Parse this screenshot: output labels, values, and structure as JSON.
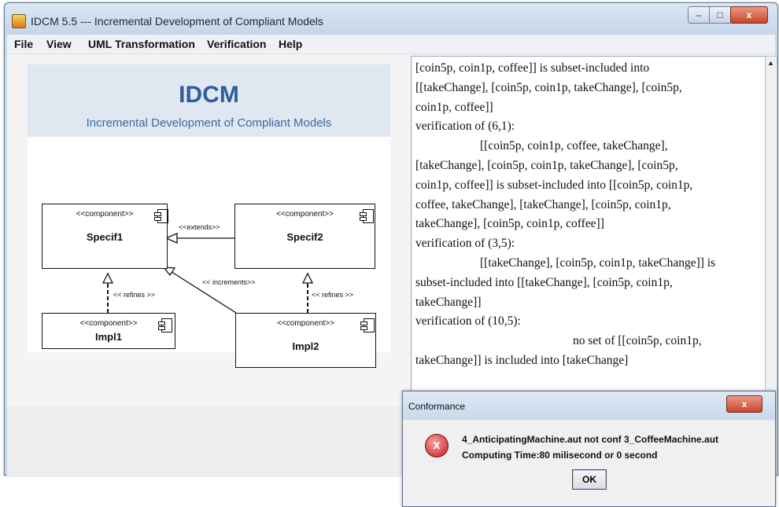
{
  "window": {
    "title": "IDCM 5.5 --- Incremental Development of Compliant Models",
    "icon": "java-app-icon",
    "controls": {
      "minimize": "–",
      "maximize": "□",
      "close": "x"
    }
  },
  "menu": [
    "File",
    "View",
    "UML Transformation",
    "Verification",
    "Help"
  ],
  "banner": {
    "title": "IDCM",
    "subtitle": "Incremental Development of Compliant Models"
  },
  "diagram": {
    "stereotype": "<<component>>",
    "components": [
      "Specif1",
      "Specif2",
      "Impl1",
      "Impl2"
    ],
    "relations": [
      "<<extends>>",
      "<< increments>>",
      "<< refines >>",
      "<< refines >>"
    ]
  },
  "output_lines": [
    "[coin5p, coin1p, coffee]] is subset-included into",
    "[[takeChange], [coin5p, coin1p, takeChange], [coin5p,",
    "coin1p, coffee]]",
    "verification of (6,1):",
    "[[coin5p, coin1p, coffee, takeChange],",
    "[takeChange], [coin5p, coin1p, takeChange], [coin5p,",
    "coin1p, coffee]] is subset-included into [[coin5p, coin1p,",
    "coffee, takeChange], [takeChange], [coin5p, coin1p,",
    "takeChange], [coin5p, coin1p, coffee]]",
    "verification of (3,5):",
    "[[takeChange], [coin5p, coin1p, takeChange]] is",
    "subset-included into [[takeChange], [coin5p, coin1p,",
    "takeChange]]",
    "verification of (10,5):",
    "no set of [[coin5p, coin1p,",
    "takeChange]] is included into [takeChange]"
  ],
  "dialog": {
    "title": "Conformance",
    "close": "x",
    "icon": "error-icon",
    "icon_glyph": "x",
    "message": "4_AnticipatingMachine.aut not conf 3_CoffeeMachine.aut",
    "time": "Computing Time:80 milisecond or 0 second",
    "ok": "OK"
  },
  "colors": {
    "banner_title": "#2f5d9a",
    "error": "#c9171a",
    "titlebar": "#c9d9ec"
  }
}
